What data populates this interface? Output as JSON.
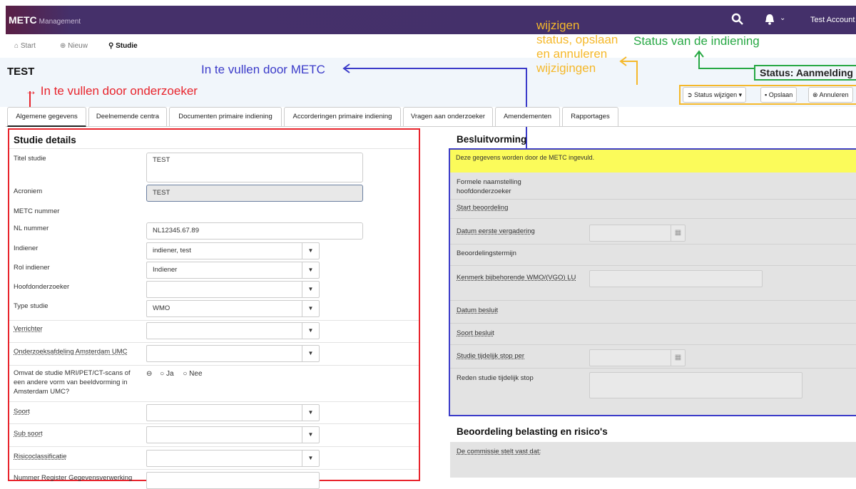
{
  "app": {
    "name": "METC",
    "subtitle": "Management"
  },
  "topbar": {
    "account": "Test Account"
  },
  "nav": {
    "start": "Start",
    "nieuw": "Nieuw",
    "studie": "Studie"
  },
  "page": {
    "title": "TEST"
  },
  "status": {
    "label": "Status: Aanmelding"
  },
  "toolbar": {
    "status_button": "Status wijzigen",
    "save": "Opslaan",
    "cancel": "Annuleren"
  },
  "annotations": {
    "onderzoeker": "In te vullen door onderzoeker",
    "metc": "In te vullen door METC",
    "wijzigen": [
      "wijzigen",
      "status, opslaan",
      "en annuleren",
      "wijzigingen"
    ],
    "status": "Status van de indiening"
  },
  "tabs": [
    "Algemene gegevens",
    "Deelnemende centra",
    "Documenten primaire indiening",
    "Accorderingen primaire indiening",
    "Vragen aan onderzoeker",
    "Amendementen",
    "Rapportages"
  ],
  "studie": {
    "title": "Studie details",
    "titel_label": "Titel studie",
    "titel_value": "TEST",
    "acroniem_label": "Acroniem",
    "acroniem_value": "TEST",
    "metc_label": "METC nummer",
    "nl_label": "NL nummer",
    "nl_value": "NL12345.67.89",
    "indiener_label": "Indiener",
    "indiener_value": "indiener, test",
    "rol_label": "Rol indiener",
    "rol_value": "Indiener",
    "hoofd_label": "Hoofdonderzoeker",
    "type_label": "Type studie",
    "type_value": "WMO",
    "verrichter_label": "Verrichter",
    "afdeling_label": "Onderzoeksafdeling Amsterdam UMC",
    "omvat_label": "Omvat de studie MRI/PET/CT-scans of een andere vorm van beeldvorming in Amsterdam UMC?",
    "ja": "Ja",
    "nee": "Nee",
    "soort_label": "Soort",
    "subsoort_label": "Sub soort",
    "risico_label": "Risicoclassificatie",
    "nummer_label": "Nummer Register Gegevensverwerking"
  },
  "besluit": {
    "title": "Besluitvorming",
    "note": "Deze gegevens worden door de METC ingevuld.",
    "formele": "Formele naamstelling hoofdonderzoeker",
    "start": "Start beoordeling",
    "datum_verg": "Datum eerste vergadering",
    "termijn": "Beoordelingstermijn",
    "kenmerk": "Kenmerk bijbehorende WMO/(VGO) LU",
    "datum_besluit": "Datum besluit",
    "soort_besluit": "Soort besluit",
    "stop_per": "Studie tijdelijk stop per",
    "reden": "Reden studie tijdelijk stop"
  },
  "risico": {
    "title": "Beoordeling belasting en risico's",
    "commissie": "De commissie stelt vast dat:"
  },
  "colors": {
    "topbar": "#45306a",
    "red": "#e8242c",
    "blue": "#3b3bc9",
    "yellow": "#f5b82a",
    "green": "#27a844"
  }
}
